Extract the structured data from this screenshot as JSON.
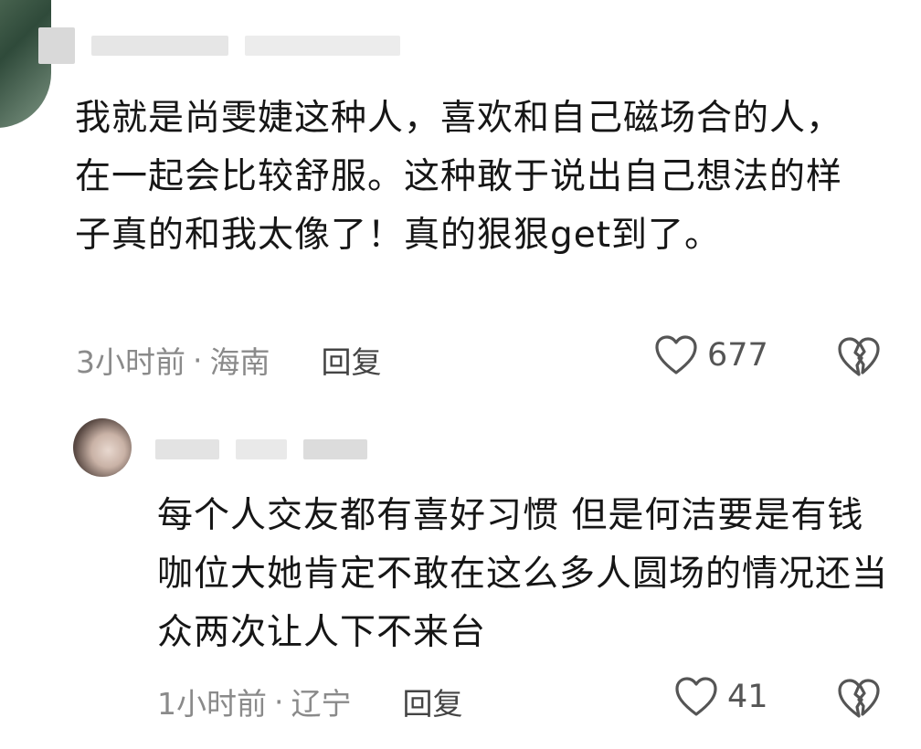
{
  "comments": [
    {
      "text": "我就是尚雯婕这种人，喜欢和自己磁场合的人，在一起会比较舒服。这种敢于说出自己想法的样子真的和我太像了！真的狠狠get到了。",
      "time": "3小时前",
      "location": "海南",
      "reply_label": "回复",
      "likes": "677",
      "icons": {
        "like": "heart-icon",
        "dislike": "broken-heart-icon"
      }
    },
    {
      "text": "每个人交友都有喜好习惯 但是何洁要是有钱咖位大她肯定不敢在这么多人圆场的情况还当众两次让人下不来台",
      "time": "1小时前",
      "location": "辽宁",
      "reply_label": "回复",
      "likes": "41",
      "icons": {
        "like": "heart-icon",
        "dislike": "broken-heart-icon"
      }
    }
  ],
  "colors": {
    "text": "#161616",
    "meta": "#8a8a8a",
    "icon": "#555555",
    "background": "#ffffff"
  }
}
